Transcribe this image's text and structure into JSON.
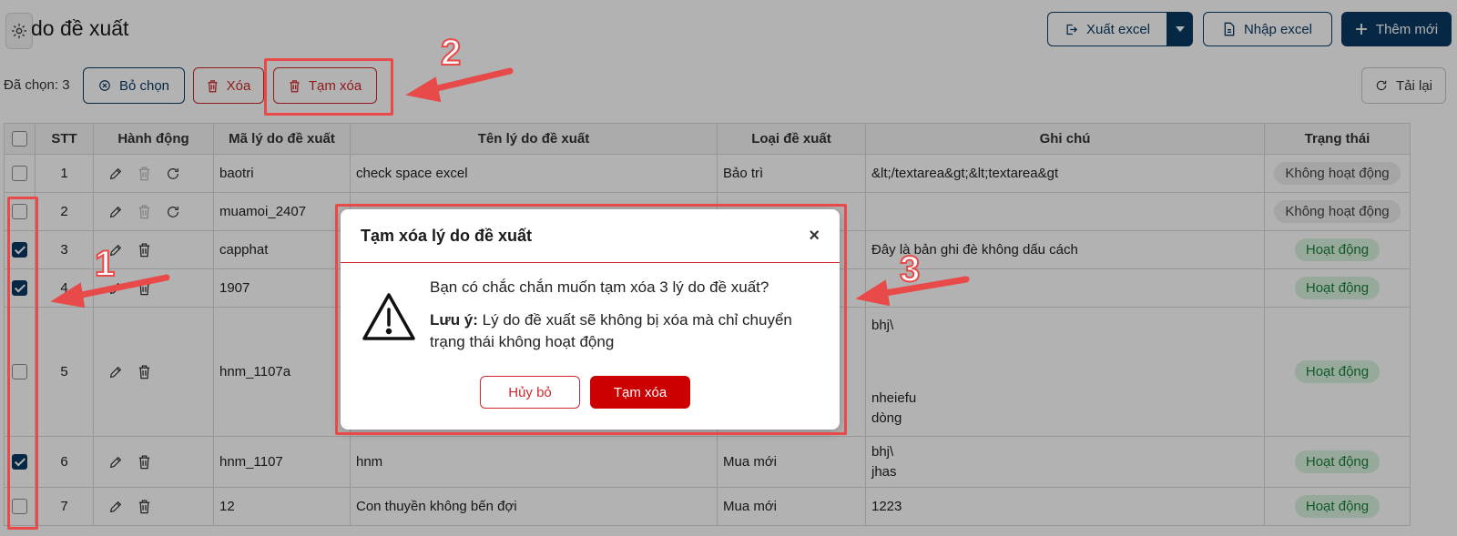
{
  "header": {
    "title": "do đề xuất",
    "export_label": "Xuất excel",
    "import_label": "Nhập excel",
    "add_label": "Thêm mới",
    "reload_label": "Tải lại"
  },
  "selection": {
    "label": "Đã chọn: 3",
    "deselect_label": "Bỏ chọn",
    "delete_label": "Xóa",
    "soft_delete_label": "Tạm xóa"
  },
  "table": {
    "columns": [
      "STT",
      "Hành động",
      "Mã lý do đề xuất",
      "Tên lý do đề xuất",
      "Loại đề xuất",
      "Ghi chú",
      "Trạng thái"
    ],
    "rows": [
      {
        "stt": "1",
        "code": "baotri",
        "name": "check space excel",
        "type": "Bảo trì",
        "note": "&lt;/textarea&gt;&lt;textarea&gt",
        "note2": "",
        "note3": "",
        "status": "Không hoạt động",
        "active": false,
        "checked": false,
        "restore": true
      },
      {
        "stt": "2",
        "code": "muamoi_2407",
        "name": "",
        "type": "",
        "note": "",
        "note2": "",
        "note3": "",
        "status": "Không hoạt động",
        "active": false,
        "checked": false,
        "restore": true
      },
      {
        "stt": "3",
        "code": "capphat",
        "name": "",
        "type": "",
        "note": "Đây là bản ghi đè không dấu cách",
        "note2": "",
        "note3": "",
        "status": "Hoạt động",
        "active": true,
        "checked": true,
        "restore": false
      },
      {
        "stt": "4",
        "code": "1907",
        "name": "",
        "type": "",
        "note": "",
        "note2": "",
        "note3": "",
        "status": "Hoạt động",
        "active": true,
        "checked": true,
        "restore": false
      },
      {
        "stt": "5",
        "code": "hnm_1107a",
        "name": "",
        "type": "",
        "note": "bhj\\",
        "note2": "nheiefu",
        "note3": "dòng",
        "status": "Hoạt động",
        "active": true,
        "checked": false,
        "restore": false
      },
      {
        "stt": "6",
        "code": "hnm_1107",
        "name": "hnm",
        "type": "Mua mới",
        "note": "bhj\\",
        "note2": "jhas",
        "note3": "",
        "status": "Hoạt động",
        "active": true,
        "checked": true,
        "restore": false
      },
      {
        "stt": "7",
        "code": "12",
        "name": "Con thuyền không bến đợi",
        "type": "Mua mới",
        "note": "1223",
        "note2": "",
        "note3": "",
        "status": "Hoạt động",
        "active": true,
        "checked": false,
        "restore": false
      }
    ]
  },
  "modal": {
    "title": "Tạm xóa lý do đề xuất",
    "close_glyph": "×",
    "question": "Bạn có chắc chắn muốn tạm xóa 3 lý do đề xuất?",
    "note_label": "Lưu ý:",
    "note_text": " Lý do đề xuất sẽ không bị xóa mà chỉ chuyển trạng thái không hoạt động",
    "cancel_label": "Hủy bỏ",
    "confirm_label": "Tạm xóa"
  },
  "annotations": {
    "n1": "1",
    "n2": "2",
    "n3": "3",
    "color": "#e84a4a"
  },
  "colors": {
    "navy": "#0b3a63",
    "red": "#cc0000",
    "active_badge_bg": "#d9f2df",
    "inactive_badge_bg": "#ececec"
  }
}
